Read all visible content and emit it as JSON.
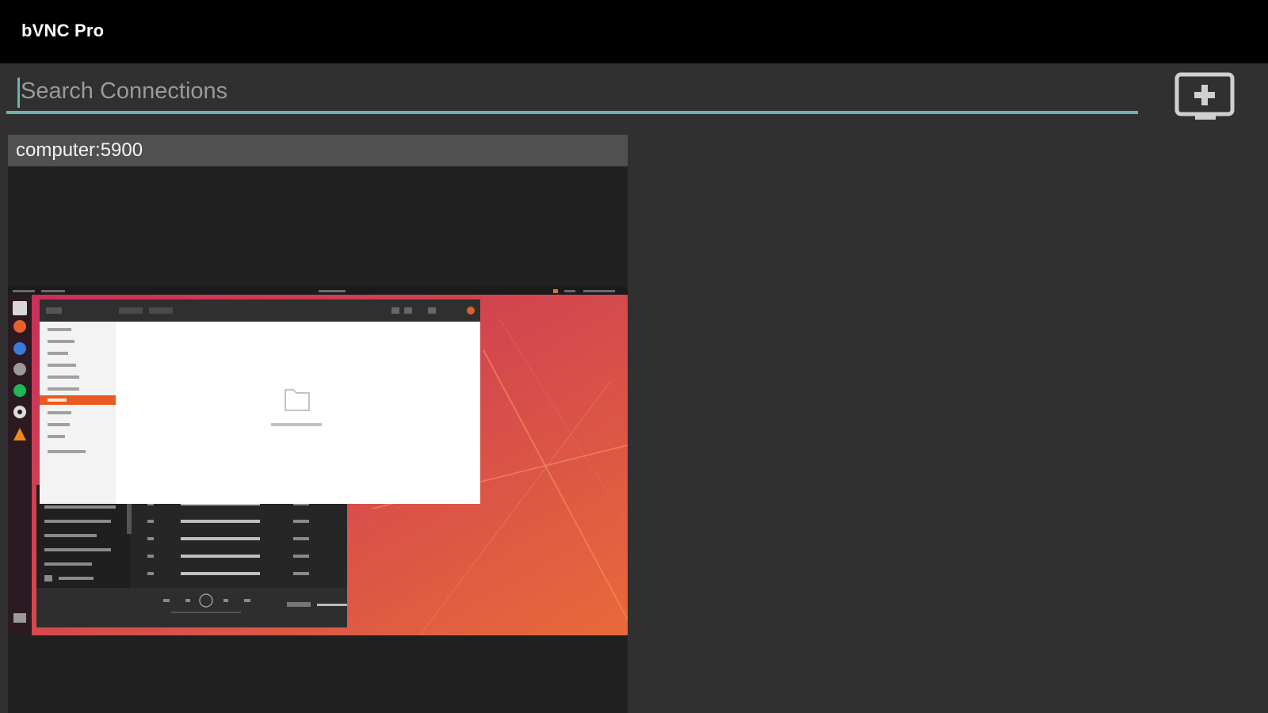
{
  "app": {
    "title": "bVNC Pro"
  },
  "search": {
    "value": "",
    "placeholder": "Search Connections"
  },
  "toolbar": {
    "add_icon": "add-connection-icon"
  },
  "connections": [
    {
      "name": "computer:5900",
      "preview_icon": "desktop-screenshot-preview"
    }
  ],
  "colors": {
    "accent": "#6fb3ae",
    "background": "#303030",
    "titlebar": "#000000",
    "card_header": "#505050",
    "card_body": "#202020"
  }
}
